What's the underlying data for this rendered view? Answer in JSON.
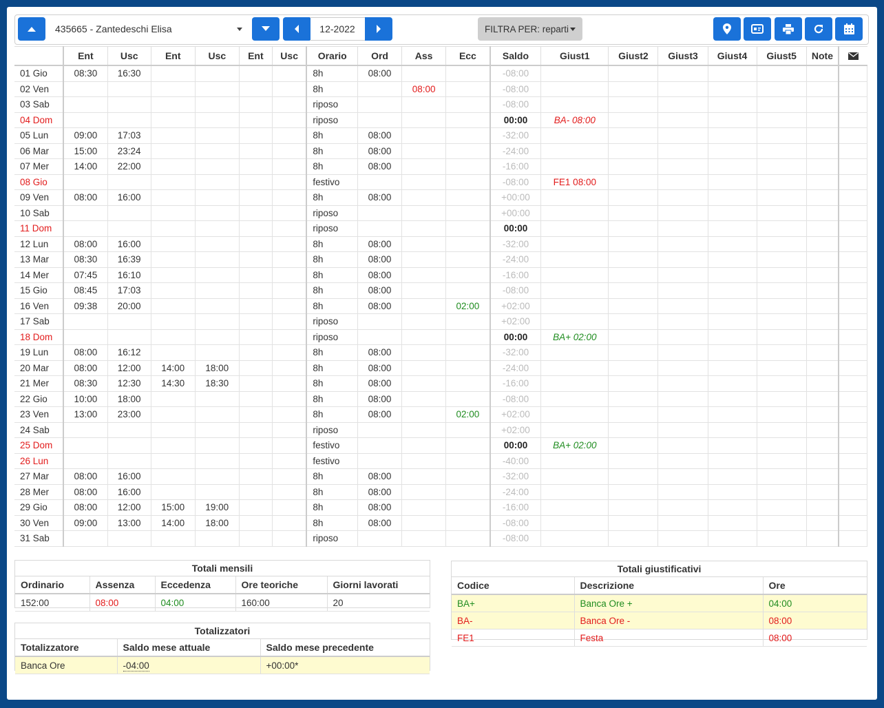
{
  "toolbar": {
    "employee": "435665 - Zantedeschi Elisa",
    "period": "12-2022",
    "filter_label": "FILTRA PER: reparti"
  },
  "table": {
    "headers": [
      "",
      "Ent",
      "Usc",
      "Ent",
      "Usc",
      "Ent",
      "Usc",
      "Orario",
      "Ord",
      "Ass",
      "Ecc",
      "Saldo",
      "Giust1",
      "Giust2",
      "Giust3",
      "Giust4",
      "Giust5",
      "Note"
    ],
    "rows": [
      {
        "day": "01 Gio",
        "red": false,
        "e1": "08:30",
        "u1": "16:30",
        "e2": "",
        "u2": "",
        "orario": "8h",
        "ord": "08:00",
        "ass": "",
        "ecc": "",
        "saldo": "-08:00",
        "saldo_bold": false,
        "g1": "",
        "g1_style": ""
      },
      {
        "day": "02 Ven",
        "red": false,
        "e1": "",
        "u1": "",
        "e2": "",
        "u2": "",
        "orario": "8h",
        "ord": "",
        "ass": "08:00",
        "ecc": "",
        "saldo": "-08:00",
        "saldo_bold": false,
        "g1": "",
        "g1_style": ""
      },
      {
        "day": "03 Sab",
        "red": false,
        "e1": "",
        "u1": "",
        "e2": "",
        "u2": "",
        "orario": "riposo",
        "ord": "",
        "ass": "",
        "ecc": "",
        "saldo": "-08:00",
        "saldo_bold": false,
        "g1": "",
        "g1_style": ""
      },
      {
        "day": "04 Dom",
        "red": true,
        "e1": "",
        "u1": "",
        "e2": "",
        "u2": "",
        "orario": "riposo",
        "ord": "",
        "ass": "",
        "ecc": "",
        "saldo": "00:00",
        "saldo_bold": true,
        "g1": "BA- 08:00",
        "g1_style": "red it"
      },
      {
        "day": "05 Lun",
        "red": false,
        "e1": "09:00",
        "u1": "17:03",
        "e2": "",
        "u2": "",
        "orario": "8h",
        "ord": "08:00",
        "ass": "",
        "ecc": "",
        "saldo": "-32:00",
        "saldo_bold": false,
        "g1": "",
        "g1_style": ""
      },
      {
        "day": "06 Mar",
        "red": false,
        "e1": "15:00",
        "u1": "23:24",
        "e2": "",
        "u2": "",
        "orario": "8h",
        "ord": "08:00",
        "ass": "",
        "ecc": "",
        "saldo": "-24:00",
        "saldo_bold": false,
        "g1": "",
        "g1_style": ""
      },
      {
        "day": "07 Mer",
        "red": false,
        "e1": "14:00",
        "u1": "22:00",
        "e2": "",
        "u2": "",
        "orario": "8h",
        "ord": "08:00",
        "ass": "",
        "ecc": "",
        "saldo": "-16:00",
        "saldo_bold": false,
        "g1": "",
        "g1_style": ""
      },
      {
        "day": "08 Gio",
        "red": true,
        "e1": "",
        "u1": "",
        "e2": "",
        "u2": "",
        "orario": "festivo",
        "ord": "",
        "ass": "",
        "ecc": "",
        "saldo": "-08:00",
        "saldo_bold": false,
        "g1": "FE1 08:00",
        "g1_style": "red"
      },
      {
        "day": "09 Ven",
        "red": false,
        "e1": "08:00",
        "u1": "16:00",
        "e2": "",
        "u2": "",
        "orario": "8h",
        "ord": "08:00",
        "ass": "",
        "ecc": "",
        "saldo": "+00:00",
        "saldo_bold": false,
        "g1": "",
        "g1_style": ""
      },
      {
        "day": "10 Sab",
        "red": false,
        "e1": "",
        "u1": "",
        "e2": "",
        "u2": "",
        "orario": "riposo",
        "ord": "",
        "ass": "",
        "ecc": "",
        "saldo": "+00:00",
        "saldo_bold": false,
        "g1": "",
        "g1_style": ""
      },
      {
        "day": "11 Dom",
        "red": true,
        "e1": "",
        "u1": "",
        "e2": "",
        "u2": "",
        "orario": "riposo",
        "ord": "",
        "ass": "",
        "ecc": "",
        "saldo": "00:00",
        "saldo_bold": true,
        "g1": "",
        "g1_style": ""
      },
      {
        "day": "12 Lun",
        "red": false,
        "e1": "08:00",
        "u1": "16:00",
        "e2": "",
        "u2": "",
        "orario": "8h",
        "ord": "08:00",
        "ass": "",
        "ecc": "",
        "saldo": "-32:00",
        "saldo_bold": false,
        "g1": "",
        "g1_style": ""
      },
      {
        "day": "13 Mar",
        "red": false,
        "e1": "08:30",
        "u1": "16:39",
        "e2": "",
        "u2": "",
        "orario": "8h",
        "ord": "08:00",
        "ass": "",
        "ecc": "",
        "saldo": "-24:00",
        "saldo_bold": false,
        "g1": "",
        "g1_style": ""
      },
      {
        "day": "14 Mer",
        "red": false,
        "e1": "07:45",
        "u1": "16:10",
        "e2": "",
        "u2": "",
        "orario": "8h",
        "ord": "08:00",
        "ass": "",
        "ecc": "",
        "saldo": "-16:00",
        "saldo_bold": false,
        "g1": "",
        "g1_style": ""
      },
      {
        "day": "15 Gio",
        "red": false,
        "e1": "08:45",
        "u1": "17:03",
        "e2": "",
        "u2": "",
        "orario": "8h",
        "ord": "08:00",
        "ass": "",
        "ecc": "",
        "saldo": "-08:00",
        "saldo_bold": false,
        "g1": "",
        "g1_style": ""
      },
      {
        "day": "16 Ven",
        "red": false,
        "e1": "09:38",
        "u1": "20:00",
        "e2": "",
        "u2": "",
        "orario": "8h",
        "ord": "08:00",
        "ass": "",
        "ecc": "02:00",
        "saldo": "+02:00",
        "saldo_bold": false,
        "g1": "",
        "g1_style": ""
      },
      {
        "day": "17 Sab",
        "red": false,
        "e1": "",
        "u1": "",
        "e2": "",
        "u2": "",
        "orario": "riposo",
        "ord": "",
        "ass": "",
        "ecc": "",
        "saldo": "+02:00",
        "saldo_bold": false,
        "g1": "",
        "g1_style": ""
      },
      {
        "day": "18 Dom",
        "red": true,
        "e1": "",
        "u1": "",
        "e2": "",
        "u2": "",
        "orario": "riposo",
        "ord": "",
        "ass": "",
        "ecc": "",
        "saldo": "00:00",
        "saldo_bold": true,
        "g1": "BA+ 02:00",
        "g1_style": "green it"
      },
      {
        "day": "19 Lun",
        "red": false,
        "e1": "08:00",
        "u1": "16:12",
        "e2": "",
        "u2": "",
        "orario": "8h",
        "ord": "08:00",
        "ass": "",
        "ecc": "",
        "saldo": "-32:00",
        "saldo_bold": false,
        "g1": "",
        "g1_style": ""
      },
      {
        "day": "20 Mar",
        "red": false,
        "e1": "08:00",
        "u1": "12:00",
        "e2": "14:00",
        "u2": "18:00",
        "orario": "8h",
        "ord": "08:00",
        "ass": "",
        "ecc": "",
        "saldo": "-24:00",
        "saldo_bold": false,
        "g1": "",
        "g1_style": ""
      },
      {
        "day": "21 Mer",
        "red": false,
        "e1": "08:30",
        "u1": "12:30",
        "e2": "14:30",
        "u2": "18:30",
        "orario": "8h",
        "ord": "08:00",
        "ass": "",
        "ecc": "",
        "saldo": "-16:00",
        "saldo_bold": false,
        "g1": "",
        "g1_style": ""
      },
      {
        "day": "22 Gio",
        "red": false,
        "e1": "10:00",
        "u1": "18:00",
        "e2": "",
        "u2": "",
        "orario": "8h",
        "ord": "08:00",
        "ass": "",
        "ecc": "",
        "saldo": "-08:00",
        "saldo_bold": false,
        "g1": "",
        "g1_style": ""
      },
      {
        "day": "23 Ven",
        "red": false,
        "e1": "13:00",
        "u1": "23:00",
        "e2": "",
        "u2": "",
        "orario": "8h",
        "ord": "08:00",
        "ass": "",
        "ecc": "02:00",
        "saldo": "+02:00",
        "saldo_bold": false,
        "g1": "",
        "g1_style": ""
      },
      {
        "day": "24 Sab",
        "red": false,
        "e1": "",
        "u1": "",
        "e2": "",
        "u2": "",
        "orario": "riposo",
        "ord": "",
        "ass": "",
        "ecc": "",
        "saldo": "+02:00",
        "saldo_bold": false,
        "g1": "",
        "g1_style": ""
      },
      {
        "day": "25 Dom",
        "red": true,
        "e1": "",
        "u1": "",
        "e2": "",
        "u2": "",
        "orario": "festivo",
        "ord": "",
        "ass": "",
        "ecc": "",
        "saldo": "00:00",
        "saldo_bold": true,
        "g1": "BA+ 02:00",
        "g1_style": "green it"
      },
      {
        "day": "26 Lun",
        "red": true,
        "e1": "",
        "u1": "",
        "e2": "",
        "u2": "",
        "orario": "festivo",
        "ord": "",
        "ass": "",
        "ecc": "",
        "saldo": "-40:00",
        "saldo_bold": false,
        "g1": "",
        "g1_style": ""
      },
      {
        "day": "27 Mar",
        "red": false,
        "e1": "08:00",
        "u1": "16:00",
        "e2": "",
        "u2": "",
        "orario": "8h",
        "ord": "08:00",
        "ass": "",
        "ecc": "",
        "saldo": "-32:00",
        "saldo_bold": false,
        "g1": "",
        "g1_style": ""
      },
      {
        "day": "28 Mer",
        "red": false,
        "e1": "08:00",
        "u1": "16:00",
        "e2": "",
        "u2": "",
        "orario": "8h",
        "ord": "08:00",
        "ass": "",
        "ecc": "",
        "saldo": "-24:00",
        "saldo_bold": false,
        "g1": "",
        "g1_style": ""
      },
      {
        "day": "29 Gio",
        "red": false,
        "e1": "08:00",
        "u1": "12:00",
        "e2": "15:00",
        "u2": "19:00",
        "orario": "8h",
        "ord": "08:00",
        "ass": "",
        "ecc": "",
        "saldo": "-16:00",
        "saldo_bold": false,
        "g1": "",
        "g1_style": ""
      },
      {
        "day": "30 Ven",
        "red": false,
        "e1": "09:00",
        "u1": "13:00",
        "e2": "14:00",
        "u2": "18:00",
        "orario": "8h",
        "ord": "08:00",
        "ass": "",
        "ecc": "",
        "saldo": "-08:00",
        "saldo_bold": false,
        "g1": "",
        "g1_style": ""
      },
      {
        "day": "31 Sab",
        "red": false,
        "e1": "",
        "u1": "",
        "e2": "",
        "u2": "",
        "orario": "riposo",
        "ord": "",
        "ass": "",
        "ecc": "",
        "saldo": "-08:00",
        "saldo_bold": false,
        "g1": "",
        "g1_style": ""
      }
    ]
  },
  "totali_mensili": {
    "title": "Totali mensili",
    "headers": [
      "Ordinario",
      "Assenza",
      "Eccedenza",
      "Ore teoriche",
      "Giorni lavorati"
    ],
    "values": [
      "152:00",
      "08:00",
      "04:00",
      "160:00",
      "20"
    ]
  },
  "totalizzatori": {
    "title": "Totalizzatori",
    "headers": [
      "Totalizzatore",
      "Saldo mese attuale",
      "Saldo mese precedente"
    ],
    "row": [
      "Banca Ore",
      "-04:00",
      "+00:00*"
    ]
  },
  "totali_giustificativi": {
    "title": "Totali giustificativi",
    "headers": [
      "Codice",
      "Descrizione",
      "Ore"
    ],
    "rows": [
      {
        "codice": "BA+",
        "descrizione": "Banca Ore +",
        "ore": "04:00",
        "color": "green",
        "yellow": true
      },
      {
        "codice": "BA-",
        "descrizione": "Banca Ore -",
        "ore": "08:00",
        "color": "red",
        "yellow": true
      },
      {
        "codice": "FE1",
        "descrizione": "Festa",
        "ore": "08:00",
        "color": "red",
        "yellow": false
      }
    ]
  },
  "colors": {
    "accent": "#1a72d9",
    "background": "#0b4887",
    "red": "#e21b1b",
    "green": "#1f8c1f",
    "yellow_row": "#fefbd0"
  },
  "icons": [
    "arrow-up-icon",
    "arrow-down-icon",
    "chevron-left-icon",
    "chevron-right-icon",
    "map-marker-icon",
    "id-card-icon",
    "print-icon",
    "refresh-icon",
    "calendar-icon",
    "envelope-icon"
  ]
}
